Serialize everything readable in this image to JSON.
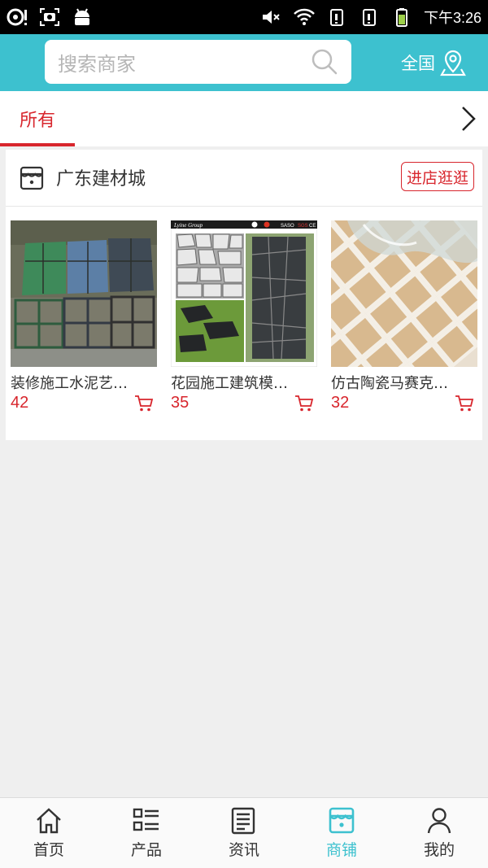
{
  "status_bar": {
    "time": "下午3:26",
    "icons": [
      "notification-icon",
      "screenshot-icon",
      "android-icon",
      "mute-icon",
      "wifi-icon",
      "sim1-icon",
      "sim2-icon",
      "battery-icon"
    ]
  },
  "header": {
    "search_placeholder": "搜索商家",
    "region_label": "全国"
  },
  "tabs": {
    "active": "所有"
  },
  "shop": {
    "name": "广东建材城",
    "visit_label": "进店逛逛",
    "products": [
      {
        "title": "装修施工水泥艺…",
        "price": "42"
      },
      {
        "title": "花园施工建筑模…",
        "price": "35"
      },
      {
        "title": "仿古陶瓷马赛克…",
        "price": "32"
      }
    ]
  },
  "thumb2_texts": {
    "brand": "Lyine Group",
    "cert1": "SASO",
    "cert2": "SGS",
    "cert3": "CE"
  },
  "bottom_nav": [
    {
      "label": "首页",
      "icon": "home-icon"
    },
    {
      "label": "产品",
      "icon": "list-icon"
    },
    {
      "label": "资讯",
      "icon": "news-icon"
    },
    {
      "label": "商铺",
      "icon": "shop-icon",
      "active": true
    },
    {
      "label": "我的",
      "icon": "user-icon"
    }
  ],
  "colors": {
    "accent": "#3dc1cf",
    "red": "#d8262d"
  }
}
